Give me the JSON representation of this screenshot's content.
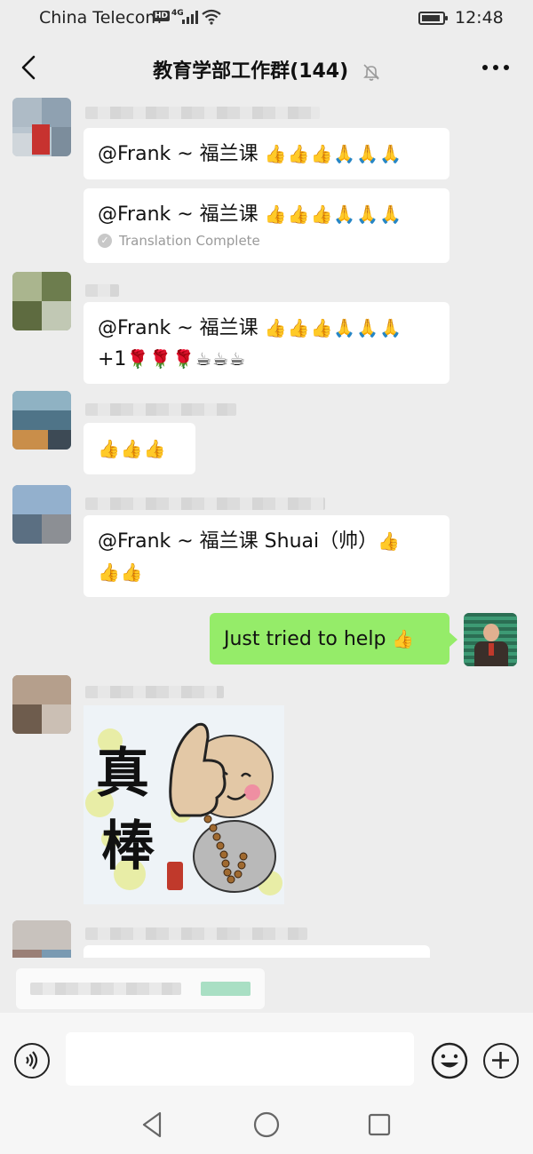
{
  "status_bar": {
    "carrier": "China Telecom",
    "hd_badge": "HD",
    "network": "4G",
    "time": "12:48"
  },
  "header": {
    "title": "教育学部工作群(144)",
    "back_icon": "chevron-left-icon",
    "mute_icon": "bell-off-icon",
    "more_icon": "more-dots-icon"
  },
  "messages": [
    {
      "text_prefix": "@Frank ~ 福兰课 ",
      "emoji": "👍👍👍🙏🙏🙏"
    },
    {
      "text_prefix": "@Frank ~ 福兰课 ",
      "emoji": "👍👍👍🙏🙏🙏",
      "note": "Translation Complete"
    },
    {
      "text_prefix": "@Frank ~ 福兰课 ",
      "emoji": "👍👍👍🙏🙏🙏",
      "line2_prefix": "+1",
      "line2_emoji": "🌹🌹🌹☕☕☕"
    },
    {
      "emoji": "👍👍👍"
    },
    {
      "text_prefix": "@Frank ~ 福兰课 Shuai（帅）",
      "emoji": "👍",
      "line2_emoji": "👍👍"
    },
    {
      "self": true,
      "text_prefix": "Just tried to help ",
      "emoji": "👍"
    }
  ],
  "sticker": {
    "chars": [
      "真",
      "棒"
    ]
  },
  "input_bar": {
    "voice_icon": "voice-icon",
    "emoji_icon": "smiley-icon",
    "plus_icon": "plus-icon"
  },
  "nav_bar": {
    "back": "triangle-back-icon",
    "home": "circle-home-icon",
    "recents": "square-recents-icon"
  },
  "colors": {
    "background": "#ededed",
    "self_bubble": "#95ec69",
    "other_bubble": "#ffffff"
  }
}
